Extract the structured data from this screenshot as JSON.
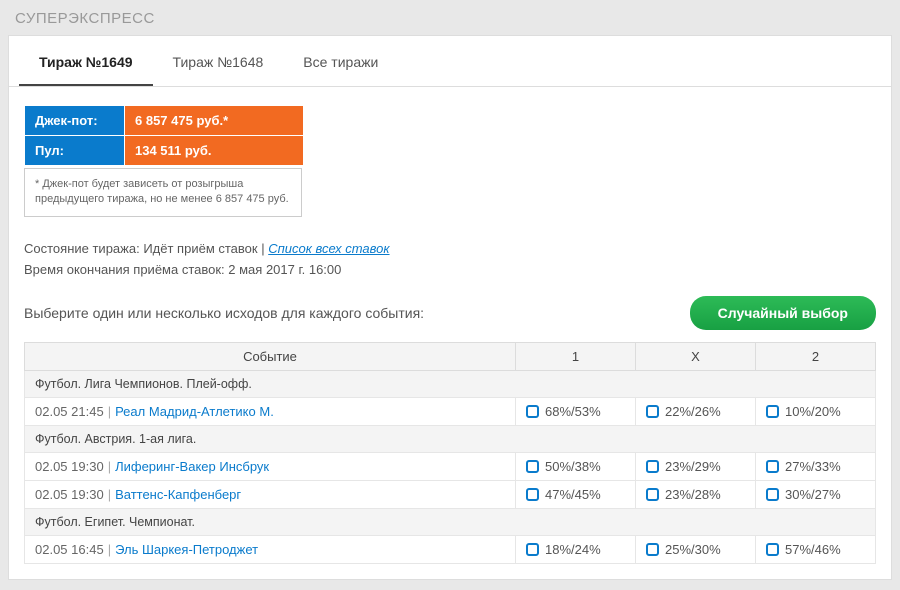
{
  "pageTitle": "СУПЕРЭКСПРЕСС",
  "tabs": [
    {
      "label": "Тираж №1649",
      "active": true
    },
    {
      "label": "Тираж №1648",
      "active": false
    },
    {
      "label": "Все тиражи",
      "active": false
    }
  ],
  "info": {
    "jackpotLabel": "Джек-пот:",
    "jackpotValue": "6 857 475 руб.*",
    "poolLabel": "Пул:",
    "poolValue": "134 511 руб."
  },
  "disclaimer": "* Джек-пот будет зависеть от розыгрыша предыдущего тиража, но не менее 6 857 475 руб.",
  "status": {
    "stateLabel": "Состояние тиража:",
    "stateValue": "Идёт приём ставок",
    "allBetsLink": "Список всех ставок",
    "endLabel": "Время окончания приёма ставок:",
    "endValue": "2 мая 2017 г. 16:00"
  },
  "selectPrompt": "Выберите один или несколько исходов для каждого события:",
  "randomBtn": "Случайный выбор",
  "headers": {
    "event": "Событие",
    "c1": "1",
    "cx": "X",
    "c2": "2"
  },
  "groups": [
    {
      "title": "Футбол. Лига Чемпионов. Плей-офф.",
      "rows": [
        {
          "time": "02.05 21:45",
          "teams": "Реал Мадрид-Атлетико М.",
          "p1": "68%/53%",
          "px": "22%/26%",
          "p2": "10%/20%"
        }
      ]
    },
    {
      "title": "Футбол. Австрия. 1-ая лига.",
      "rows": [
        {
          "time": "02.05 19:30",
          "teams": "Лиферинг-Вакер Инсбрук",
          "p1": "50%/38%",
          "px": "23%/29%",
          "p2": "27%/33%"
        },
        {
          "time": "02.05 19:30",
          "teams": "Ваттенс-Капфенберг",
          "p1": "47%/45%",
          "px": "23%/28%",
          "p2": "30%/27%"
        }
      ]
    },
    {
      "title": "Футбол. Египет. Чемпионат.",
      "rows": [
        {
          "time": "02.05 16:45",
          "teams": "Эль Шаркея-Петроджет",
          "p1": "18%/24%",
          "px": "25%/30%",
          "p2": "57%/46%"
        }
      ]
    }
  ]
}
